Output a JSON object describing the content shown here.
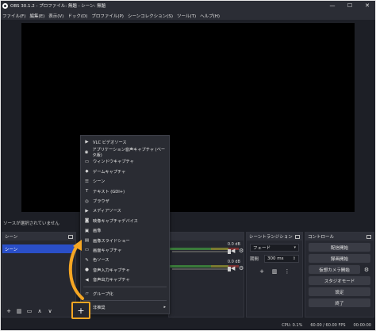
{
  "window": {
    "title": "OBS 30.1.2 - プロファイル: 無題 - シーン: 無題",
    "minimize": "—",
    "maximize": "☐",
    "close": "✕"
  },
  "menu": [
    "ファイル(F)",
    "編集(E)",
    "表示(V)",
    "ドック(D)",
    "プロファイル(P)",
    "シーンコレクション(S)",
    "ツール(T)",
    "ヘルプ(H)"
  ],
  "notice": "ソースが選択されていません",
  "scenes": {
    "title": "シーン",
    "items": [
      "シーン"
    ]
  },
  "mixer": {
    "rows": [
      {
        "db": "0.0 dB"
      },
      {
        "db": "0.0 dB"
      }
    ]
  },
  "transitions": {
    "title": "シーントランジション",
    "transition": "フェード",
    "duration_label": "期間",
    "duration": "300 ms"
  },
  "controls": {
    "title": "コントロール",
    "buttons": [
      "配信開始",
      "録画開始",
      "仮想カメラ開始",
      "スタジオモード",
      "設定",
      "終了"
    ]
  },
  "status": {
    "cpu": "CPU: 0.1%",
    "fps": "60.00 / 60.00 FPS",
    "time": "00:00:00"
  },
  "context_menu": {
    "items": [
      {
        "icon": "play-icon",
        "glyph": "▶",
        "label": "VLC ビデオソース"
      },
      {
        "icon": "app-audio-icon",
        "glyph": "◉",
        "label": "アプリケーション音声キャプチャ (ベータ版)"
      },
      {
        "icon": "window-icon",
        "glyph": "▭",
        "label": "ウィンドウキャプチャ"
      },
      {
        "icon": "gamepad-icon",
        "glyph": "◆",
        "label": "ゲームキャプチャ"
      },
      {
        "icon": "list-icon",
        "glyph": "☰",
        "label": "シーン"
      },
      {
        "icon": "text-icon",
        "glyph": "T",
        "label": "テキスト (GDI+)"
      },
      {
        "icon": "globe-icon",
        "glyph": "◎",
        "label": "ブラウザ"
      },
      {
        "icon": "media-icon",
        "glyph": "▶",
        "label": "メディアソース"
      },
      {
        "icon": "camera-icon",
        "glyph": "◙",
        "label": "映像キャプチャデバイス"
      },
      {
        "icon": "image-icon",
        "glyph": "▣",
        "label": "画像"
      },
      {
        "icon": "slideshow-icon",
        "glyph": "▤",
        "label": "画像スライドショー"
      },
      {
        "icon": "monitor-icon",
        "glyph": "▭",
        "label": "画面キャプチャ"
      },
      {
        "icon": "brush-icon",
        "glyph": "✎",
        "label": "色ソース"
      },
      {
        "icon": "mic-icon",
        "glyph": "●",
        "label": "音声入力キャプチャ"
      },
      {
        "icon": "speaker-icon",
        "glyph": "◀",
        "label": "音声出力キャプチャ"
      }
    ],
    "group": {
      "icon": "folder-icon",
      "glyph": "▱",
      "label": "グループ化"
    },
    "deprecated": {
      "label": "非推奨",
      "arrow": "▸"
    }
  },
  "add_button": "+"
}
